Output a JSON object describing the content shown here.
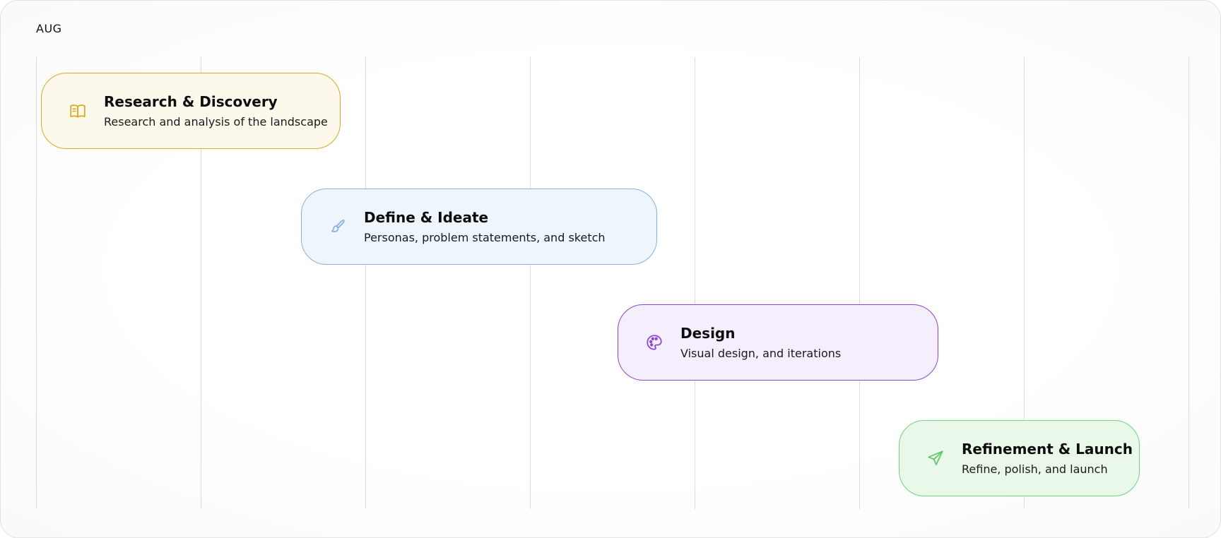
{
  "timeline": {
    "month_label": "AUG",
    "phases": [
      {
        "title": "Research & Discovery",
        "description": "Research and analysis of the landscape",
        "icon": "open-book-icon",
        "accent_color": "#d9ab1c",
        "background_color": "#fcf8ec"
      },
      {
        "title": "Define & Ideate",
        "description": "Personas, problem statements, and sketch",
        "icon": "paintbrush-icon",
        "accent_color": "#88aef0",
        "background_color": "#eef5fc"
      },
      {
        "title": "Design",
        "description": "Visual design, and iterations",
        "icon": "palette-icon",
        "accent_color": "#8a45d8",
        "background_color": "#f4eefd"
      },
      {
        "title": "Refinement & Launch",
        "description": "Refine, polish, and launch",
        "icon": "paper-plane-icon",
        "accent_color": "#6dd57b",
        "background_color": "#eaf8ea"
      }
    ]
  }
}
